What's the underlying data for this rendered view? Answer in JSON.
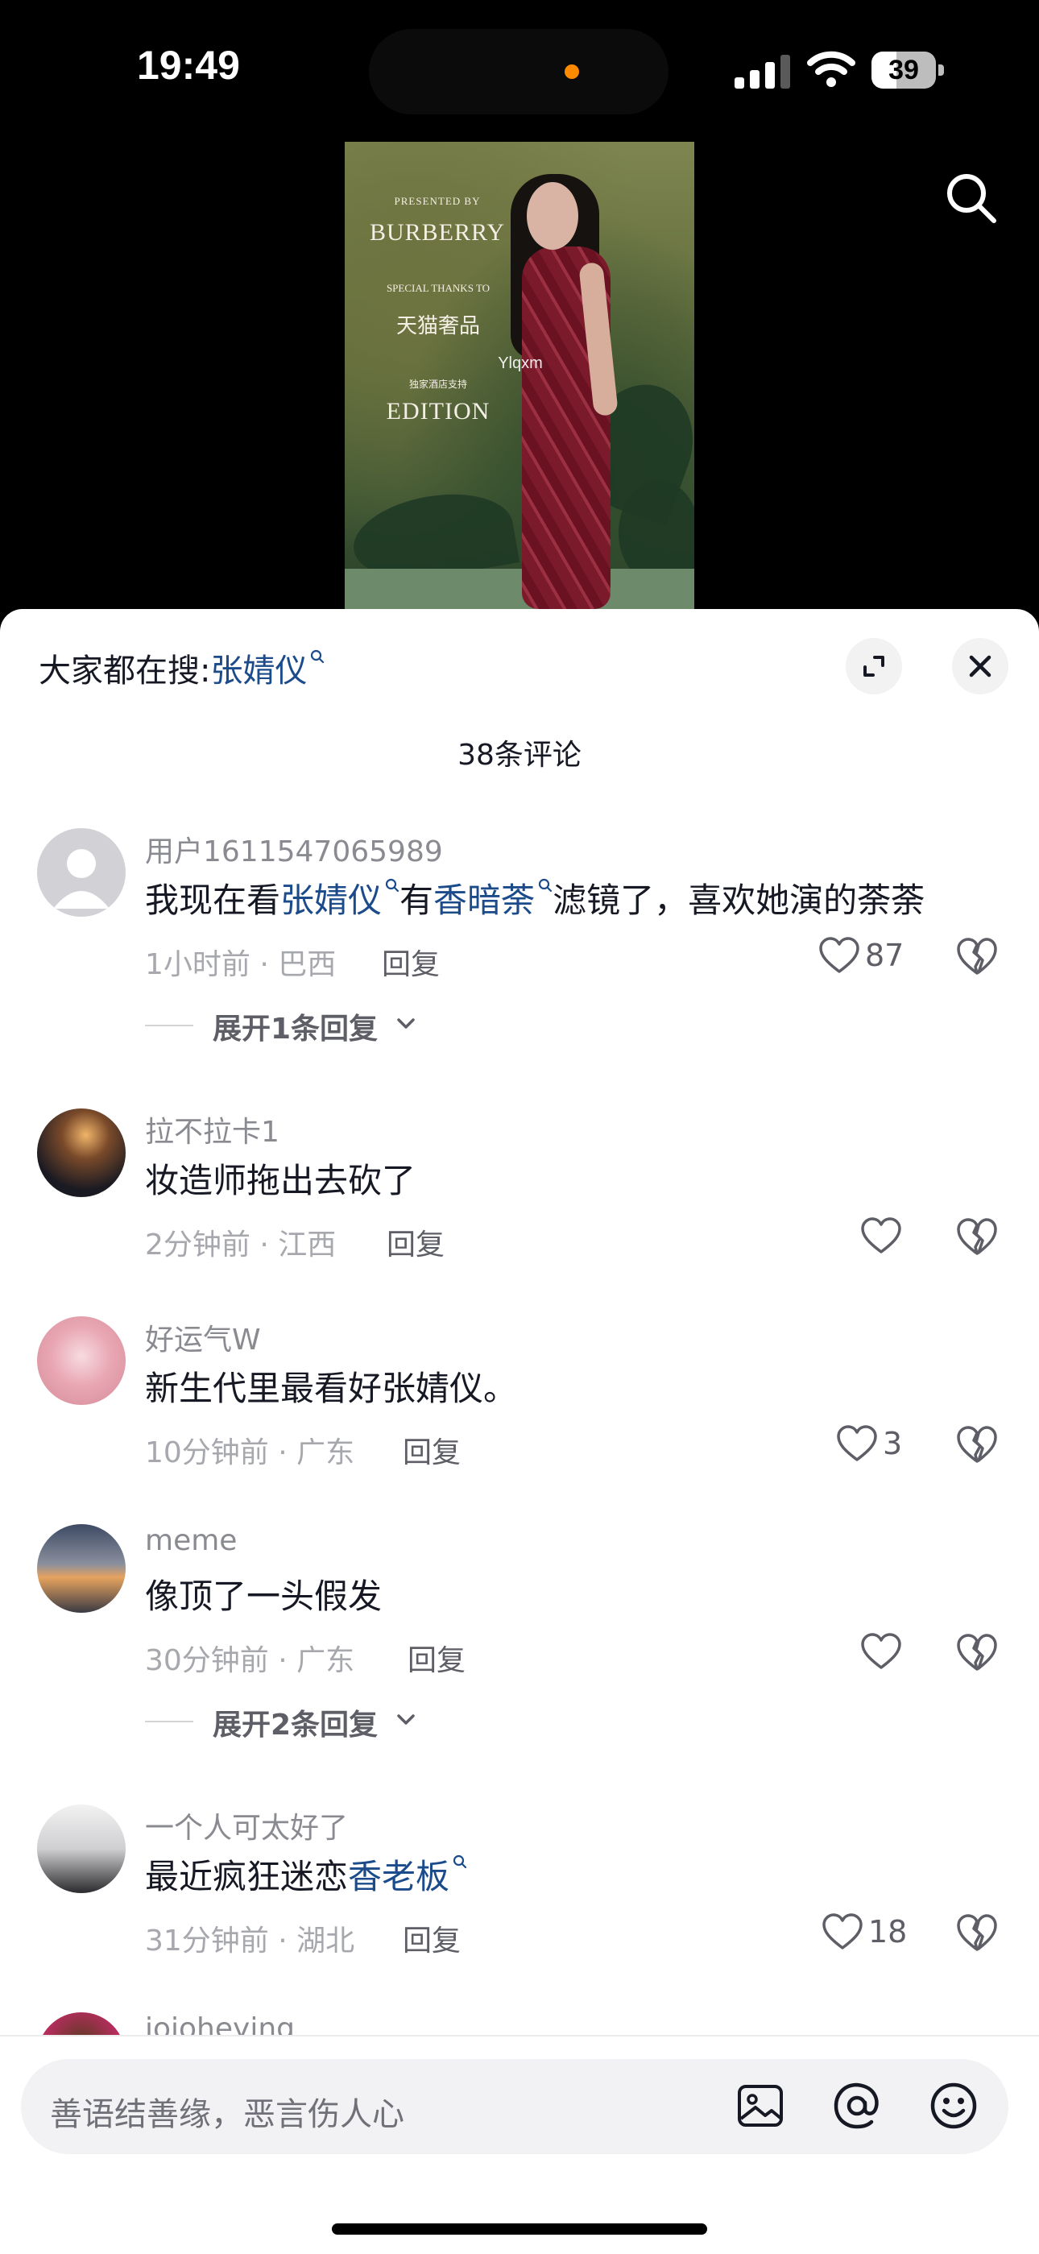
{
  "status_bar": {
    "time": "19:49",
    "battery": "39",
    "battery_level": 0.39
  },
  "video": {
    "presented_by": "PRESENTED BY",
    "brand": "BURBERRY",
    "special_thanks": "SPECIAL THANKS TO",
    "sponsor": "天猫奢品",
    "hotel_note": "独家酒店支持",
    "hotel": "EDITION",
    "watermark": "Ylqxm"
  },
  "sheet": {
    "trending_prefix": "大家都在搜:",
    "trending_keyword": "张婧仪",
    "comment_count": "38条评论"
  },
  "comments": [
    {
      "user": "用户1611547065989",
      "text_parts": [
        "我现在看",
        "张婧仪",
        "有",
        "香暗荼",
        "滤镜了，喜欢她演的荼荼"
      ],
      "time_loc": "1小时前 · 巴西",
      "reply": "回复",
      "likes": "87",
      "expand": "展开1条回复"
    },
    {
      "user": "拉不拉卡1",
      "text": "妆造师拖出去砍了",
      "time_loc": "2分钟前 · 江西",
      "reply": "回复",
      "likes": ""
    },
    {
      "user": "好运气W",
      "text": "新生代里最看好张婧仪。",
      "time_loc": "10分钟前 · 广东",
      "reply": "回复",
      "likes": "3"
    },
    {
      "user": "meme",
      "text": "像顶了一头假发",
      "time_loc": "30分钟前 · 广东",
      "reply": "回复",
      "likes": "",
      "expand": "展开2条回复"
    },
    {
      "user": "一个人可太好了",
      "text_parts": [
        "最近疯狂迷恋",
        "香老板"
      ],
      "time_loc": "31分钟前 · 湖北",
      "reply": "回复",
      "likes": "18"
    },
    {
      "user": "jojoheying"
    }
  ],
  "input": {
    "placeholder": "善语结善缘，恶言伤人心"
  },
  "colors": {
    "keyword": "#1b4b8a",
    "sheet_bg": "#ffffff",
    "screen_bg": "#000000"
  },
  "icons": [
    "search-icon",
    "expand-icon",
    "close-icon",
    "heart-icon",
    "broken-heart-icon",
    "chevron-down-icon",
    "image-icon",
    "at-icon",
    "emoji-icon"
  ]
}
